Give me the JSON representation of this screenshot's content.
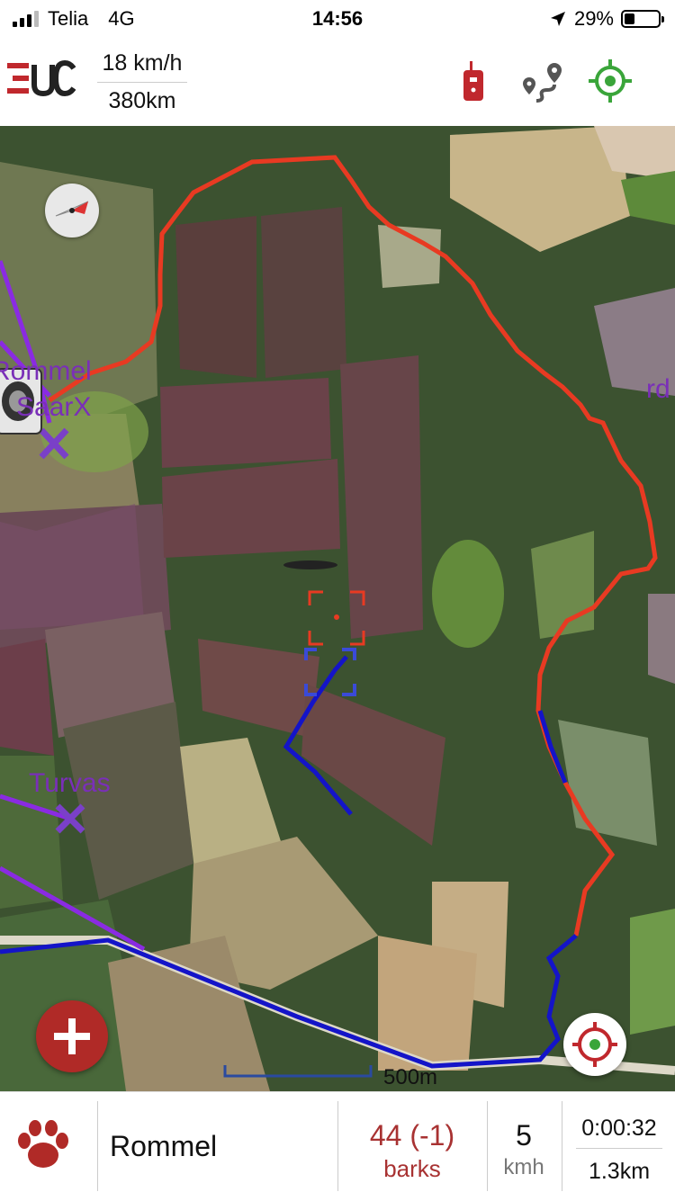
{
  "status_bar": {
    "carrier": "Telia",
    "network": "4G",
    "time": "14:56",
    "battery": "29%"
  },
  "header": {
    "logo_text": "EUC",
    "speed": "18 km/h",
    "distance": "380km",
    "icons": [
      "radio-icon",
      "route-icon",
      "locate-icon"
    ]
  },
  "map": {
    "labels": {
      "rommel": "Rommel",
      "saarx": "SaarX",
      "turvas": "Turvas",
      "edge": "rd"
    },
    "scale_label": "500m",
    "track_colors": {
      "red": "#e83a22",
      "blue": "#1414c8",
      "purple": "#8a2be2"
    }
  },
  "bottom_bar": {
    "dog_name": "Rommel",
    "barks_value": "44  (-1)",
    "barks_label": "barks",
    "speed_value": "5",
    "speed_unit": "kmh",
    "elapsed": "0:00:32",
    "distance": "1.3km"
  }
}
